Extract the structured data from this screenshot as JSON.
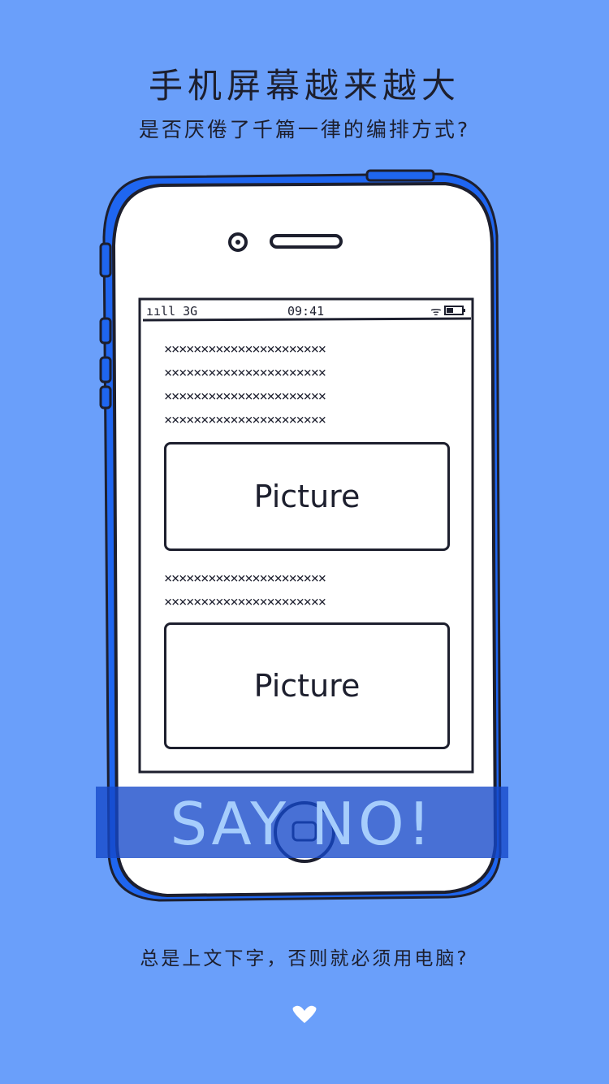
{
  "page": {
    "title": "手机屏幕越来越大",
    "subtitle": "是否厌倦了千篇一律的编排方式?",
    "bottom_text": "总是上文下字，否则就必须用电脑?"
  },
  "phone": {
    "status_bar": {
      "signal": "ııll 3G",
      "time": "09:41",
      "battery_icon": "battery-icon"
    },
    "content": {
      "text_rows_top": [
        "××××××××××××××××××××××",
        "××××××××××××××××××××××",
        "××××××××××××××××××××××",
        "××××××××××××××××××××××"
      ],
      "picture_1": "Picture",
      "text_rows_middle": [
        "××××××××××××××××××××××",
        "××××××××××××××××××××××"
      ],
      "picture_2": "Picture"
    }
  },
  "banner": {
    "text": "SAY NO!"
  },
  "navigation": {
    "next_icon": "chevron-down-icon"
  },
  "colors": {
    "background": "#6a9ffa",
    "ink": "#1d1f2e",
    "banner": "#1548c9",
    "banner_text": "#a6cdfc",
    "phone_fill": "#ffffff",
    "phone_outline_blue": "#1f66f0"
  }
}
